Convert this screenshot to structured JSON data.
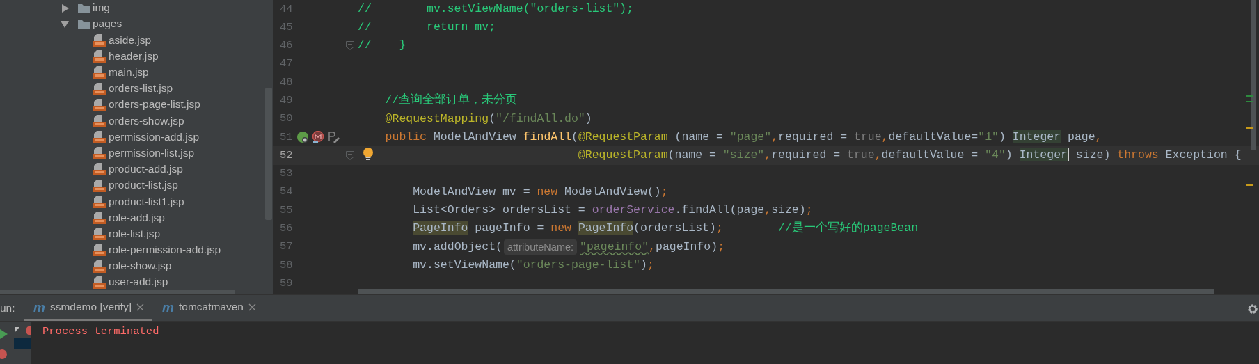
{
  "project_tree": [
    {
      "label": "img",
      "kind": "folder",
      "expanded": false
    },
    {
      "label": "pages",
      "kind": "folder",
      "expanded": true,
      "children": [
        {
          "label": "aside.jsp",
          "kind": "jsp"
        },
        {
          "label": "header.jsp",
          "kind": "jsp"
        },
        {
          "label": "main.jsp",
          "kind": "jsp"
        },
        {
          "label": "orders-list.jsp",
          "kind": "jsp"
        },
        {
          "label": "orders-page-list.jsp",
          "kind": "jsp"
        },
        {
          "label": "orders-show.jsp",
          "kind": "jsp"
        },
        {
          "label": "permission-add.jsp",
          "kind": "jsp"
        },
        {
          "label": "permission-list.jsp",
          "kind": "jsp"
        },
        {
          "label": "product-add.jsp",
          "kind": "jsp"
        },
        {
          "label": "product-list.jsp",
          "kind": "jsp"
        },
        {
          "label": "product-list1.jsp",
          "kind": "jsp"
        },
        {
          "label": "role-add.jsp",
          "kind": "jsp"
        },
        {
          "label": "role-list.jsp",
          "kind": "jsp"
        },
        {
          "label": "role-permission-add.jsp",
          "kind": "jsp"
        },
        {
          "label": "role-show.jsp",
          "kind": "jsp"
        },
        {
          "label": "user-add.jsp",
          "kind": "jsp"
        }
      ]
    }
  ],
  "editor": {
    "lines": [
      {
        "number": "44",
        "tokens": [
          {
            "t": "//        mv.setViewName(\"orders-list\");",
            "kind": "comment"
          }
        ]
      },
      {
        "number": "45",
        "tokens": [
          {
            "t": "//        return mv;",
            "kind": "comment"
          }
        ]
      },
      {
        "number": "46",
        "fold": true,
        "tokens": [
          {
            "t": "//    }",
            "kind": "comment"
          }
        ]
      },
      {
        "number": "47"
      },
      {
        "number": "48"
      },
      {
        "number": "49",
        "tokens": [
          {
            "t": "    //查询全部订单，未分页",
            "kind": "comment"
          }
        ]
      },
      {
        "number": "50",
        "tokens": [
          {
            "t": "    @RequestMapping",
            "kind": "annotation"
          },
          {
            "t": "(",
            "kind": "plain"
          },
          {
            "t": "\"/findAll.do\"",
            "kind": "string"
          },
          {
            "t": ")",
            "kind": "plain"
          }
        ]
      },
      {
        "number": "51",
        "gutter_icons": [
          {
            "kind": "bean"
          },
          {
            "kind": "mapping"
          },
          {
            "kind": "edit"
          }
        ],
        "tokens": [
          {
            "t": "    public",
            "kind": "keyword"
          },
          {
            "t": " ModelAndView ",
            "kind": "plain"
          },
          {
            "t": "findAll",
            "kind": "method"
          },
          {
            "t": "(",
            "kind": "plain"
          },
          {
            "t": "@RequestParam",
            "kind": "annotation"
          },
          {
            "t": " (name = ",
            "kind": "plain"
          },
          {
            "t": "\"page\"",
            "kind": "string"
          },
          {
            "t": ",",
            "kind": "keyword"
          },
          {
            "t": "required = ",
            "kind": "plain"
          },
          {
            "t": "true",
            "kind": "literal"
          },
          {
            "t": ",",
            "kind": "keyword"
          },
          {
            "t": "defaultValue=",
            "kind": "plain"
          },
          {
            "t": "\"1\"",
            "kind": "string"
          },
          {
            "t": ") ",
            "kind": "plain"
          },
          {
            "t": "Integer",
            "kind": "match"
          },
          {
            "t": " page",
            "kind": "plain"
          },
          {
            "t": ",",
            "kind": "keyword"
          }
        ]
      },
      {
        "number": "52",
        "current": true,
        "fold": true,
        "bulb": true,
        "tokens": [
          {
            "t": "                                @RequestParam",
            "kind": "annotation"
          },
          {
            "t": "(name = ",
            "kind": "plain"
          },
          {
            "t": "\"size\"",
            "kind": "string"
          },
          {
            "t": ",",
            "kind": "keyword"
          },
          {
            "t": "required = ",
            "kind": "plain"
          },
          {
            "t": "true",
            "kind": "literal"
          },
          {
            "t": ",",
            "kind": "keyword"
          },
          {
            "t": "defaultValue = ",
            "kind": "plain"
          },
          {
            "t": "\"4\"",
            "kind": "string"
          },
          {
            "t": ") ",
            "kind": "plain"
          },
          {
            "t": "Integer",
            "kind": "match",
            "caret": true
          },
          {
            "t": " size) ",
            "kind": "plain"
          },
          {
            "t": "throws",
            "kind": "keyword"
          },
          {
            "t": " Exception {",
            "kind": "plain"
          }
        ]
      },
      {
        "number": "53"
      },
      {
        "number": "54",
        "tokens": [
          {
            "t": "        ModelAndView mv = ",
            "kind": "plain"
          },
          {
            "t": "new",
            "kind": "keyword"
          },
          {
            "t": " ModelAndView()",
            "kind": "plain"
          },
          {
            "t": ";",
            "kind": "keyword"
          }
        ]
      },
      {
        "number": "55",
        "tokens": [
          {
            "t": "        List<Orders> ordersList = ",
            "kind": "plain"
          },
          {
            "t": "orderService",
            "kind": "field"
          },
          {
            "t": ".findAll(page",
            "kind": "plain"
          },
          {
            "t": ",",
            "kind": "keyword"
          },
          {
            "t": "size)",
            "kind": "plain"
          },
          {
            "t": ";",
            "kind": "keyword"
          }
        ]
      },
      {
        "number": "56",
        "tokens": [
          {
            "t": "        PageInfo",
            "kind": "usage"
          },
          {
            "t": " pageInfo = ",
            "kind": "plain"
          },
          {
            "t": "new ",
            "kind": "keyword"
          },
          {
            "t": "PageInfo",
            "kind": "usage"
          },
          {
            "t": "(ordersList)",
            "kind": "plain"
          },
          {
            "t": ";        ",
            "kind": "keyword"
          },
          {
            "t": "//是一个写好的pageBean",
            "kind": "comment"
          }
        ]
      },
      {
        "number": "57",
        "tokens": [
          {
            "t": "        mv.addObject(",
            "kind": "plain"
          },
          {
            "t": "attributeName:",
            "kind": "hint"
          },
          {
            "t": "\"pageinfo\"",
            "kind": "string",
            "typo": true
          },
          {
            "t": ",",
            "kind": "keyword"
          },
          {
            "t": "pageInfo)",
            "kind": "plain"
          },
          {
            "t": ";",
            "kind": "keyword"
          }
        ]
      },
      {
        "number": "58",
        "tokens": [
          {
            "t": "        mv.setViewName(",
            "kind": "plain"
          },
          {
            "t": "\"orders-page-list\"",
            "kind": "string"
          },
          {
            "t": ")",
            "kind": "plain"
          },
          {
            "t": ";",
            "kind": "keyword"
          }
        ]
      },
      {
        "number": "59"
      }
    ]
  },
  "run_panel": {
    "label": "un:",
    "tabs": [
      {
        "icon": "m",
        "label": "ssmdemo [verify]",
        "selected": true
      },
      {
        "icon": "m",
        "label": "tomcatmaven",
        "selected": false
      }
    ],
    "console": [
      {
        "text": "Process terminated",
        "kind": "error"
      }
    ]
  }
}
